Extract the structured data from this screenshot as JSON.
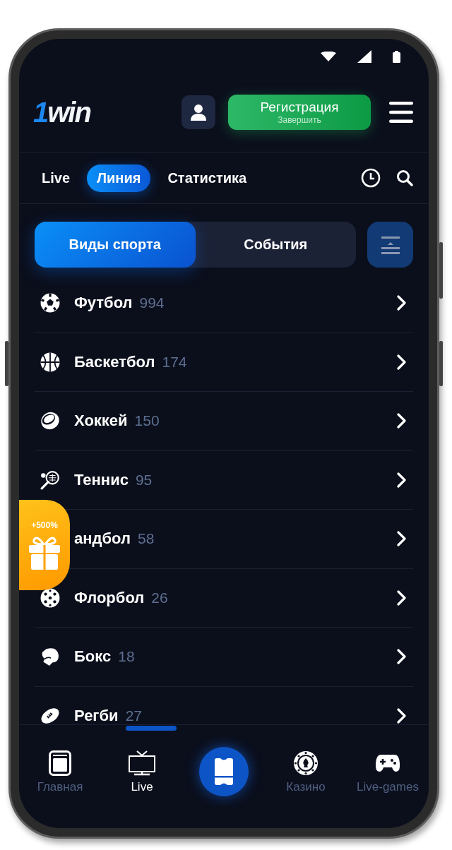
{
  "header": {
    "logo": "1win",
    "register": {
      "label": "Регистрация",
      "sublabel": "Завершить"
    }
  },
  "tabs": [
    {
      "label": "Live",
      "selected": false
    },
    {
      "label": "Линия",
      "selected": true
    },
    {
      "label": "Статистика",
      "selected": false
    }
  ],
  "segments": [
    {
      "label": "Виды спорта",
      "selected": true
    },
    {
      "label": "События",
      "selected": false
    }
  ],
  "sports": [
    {
      "kind": "football",
      "name": "Футбол",
      "count": "994"
    },
    {
      "kind": "basketball",
      "name": "Баскетбол",
      "count": "174"
    },
    {
      "kind": "hockey",
      "name": "Хоккей",
      "count": "150"
    },
    {
      "kind": "tennis",
      "name": "Теннис",
      "count": "95"
    },
    {
      "kind": "handball",
      "name": "андбол",
      "count": "58"
    },
    {
      "kind": "floorball",
      "name": "Флорбол",
      "count": "26"
    },
    {
      "kind": "boxing",
      "name": "Бокс",
      "count": "18"
    },
    {
      "kind": "rugby",
      "name": "Регби",
      "count": "27"
    }
  ],
  "promo": {
    "label": "+500%"
  },
  "nav": [
    {
      "kind": "home",
      "label": "Главная",
      "selected": false
    },
    {
      "kind": "live",
      "label": "Live",
      "selected": true
    },
    {
      "kind": "coupon",
      "selected": false
    },
    {
      "kind": "casino",
      "label": "Казино",
      "selected": false
    },
    {
      "kind": "games",
      "label": "Live-games",
      "selected": false
    }
  ]
}
